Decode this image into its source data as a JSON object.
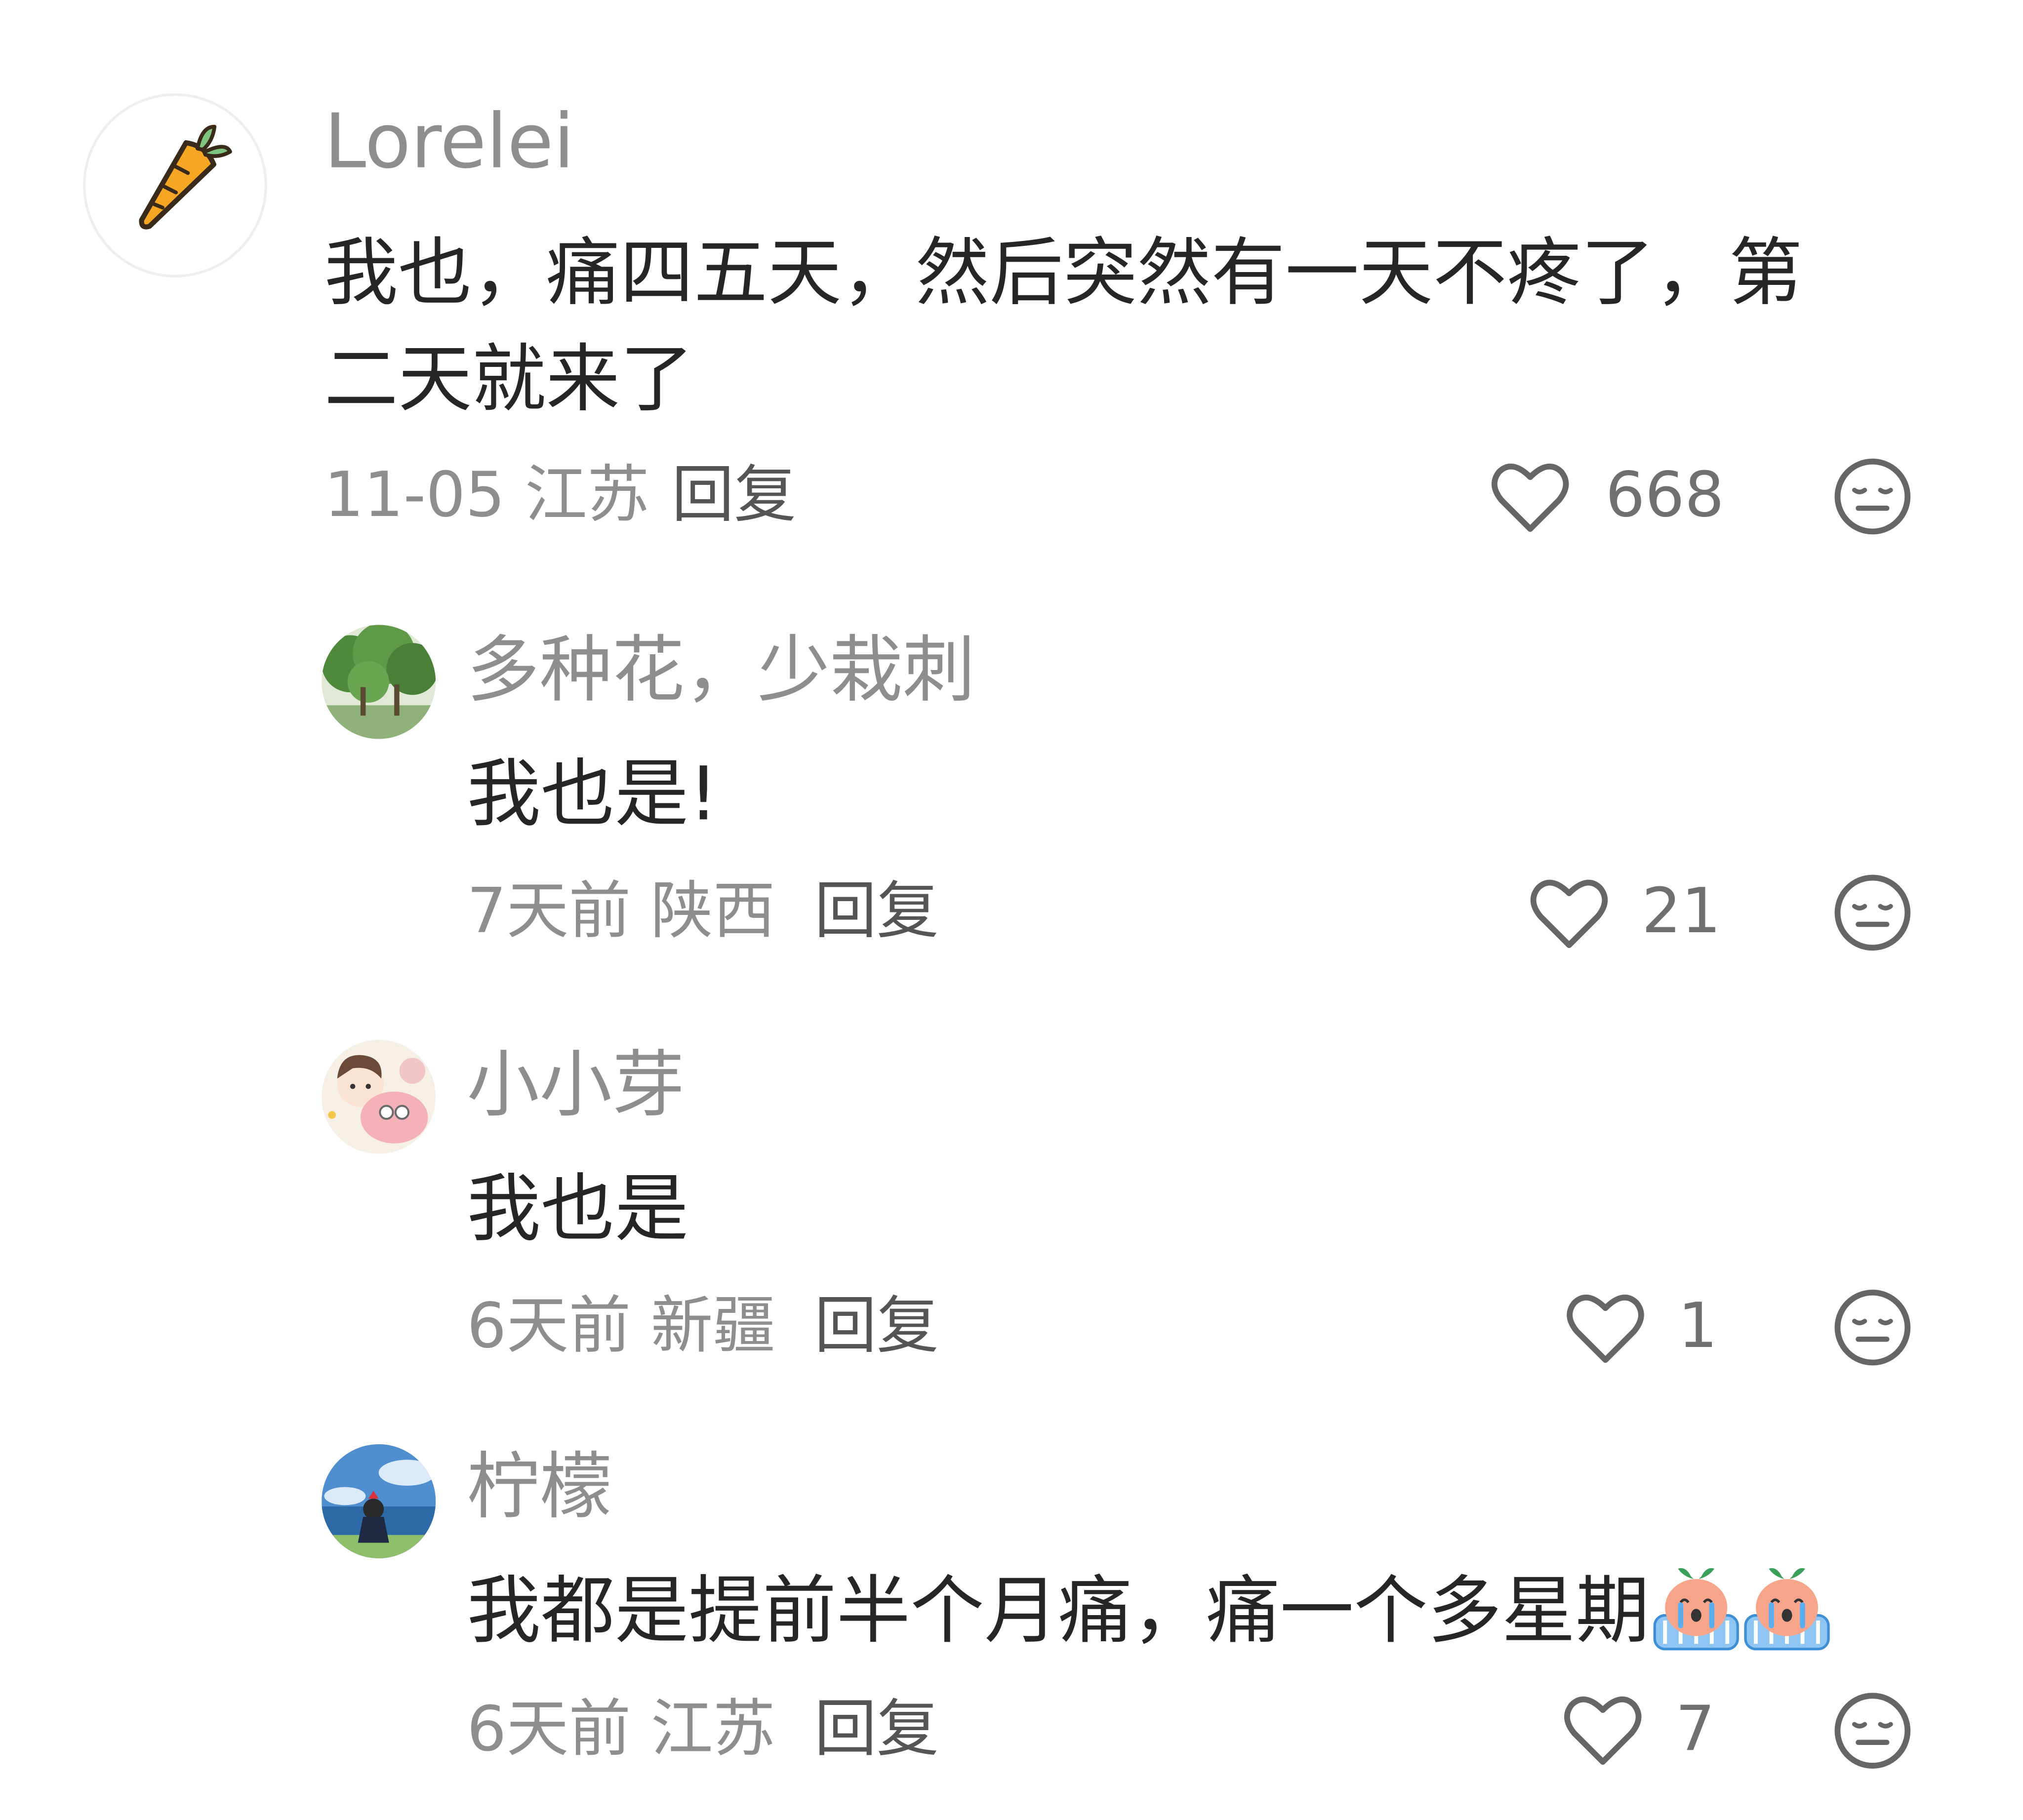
{
  "comments": [
    {
      "username": "Lorelei",
      "avatar": "carrot-avatar",
      "text_line1": "我也，痛四五天，然后突然有一天不疼了，第",
      "text_line2": "二天就来了",
      "date": "11-05",
      "location": "江苏",
      "reply_label": "回复",
      "likes": "668"
    },
    {
      "username": "多种花，少栽刺",
      "avatar": "trees-avatar",
      "text": "我也是!",
      "date": "7天前",
      "location": "陕西",
      "reply_label": "回复",
      "likes": "21"
    },
    {
      "username": "小小芽",
      "avatar": "cartoon-girl-avatar",
      "text": "我也是",
      "date": "6天前",
      "location": "新疆",
      "reply_label": "回复",
      "likes": "1"
    },
    {
      "username": "柠檬",
      "avatar": "anime-sky-avatar",
      "text": "我都是提前半个月痛，痛一个多星期",
      "emojis": [
        "crying-emoji",
        "crying-emoji"
      ],
      "date": "6天前",
      "location": "江苏",
      "reply_label": "回复",
      "likes": "7"
    }
  ],
  "icons": {
    "like": "heart-outline-icon",
    "dislike": "unamused-face-icon"
  },
  "colors": {
    "name": "#8e8e8e",
    "text": "#262626",
    "meta": "#8e8e8e",
    "icon": "#666666"
  }
}
